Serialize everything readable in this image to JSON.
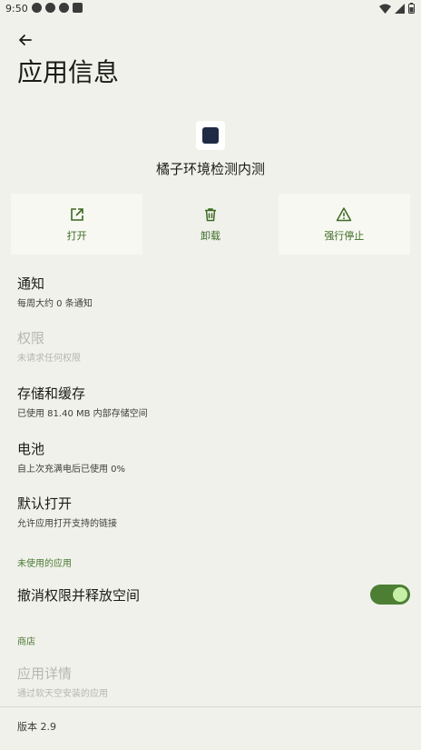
{
  "status_bar": {
    "time": "9:50",
    "left_icons": [
      "notification-icon",
      "telegram-icon",
      "telegram-icon",
      "android-icon"
    ],
    "right_icons": [
      "wifi-icon",
      "signal-icon",
      "battery-icon"
    ]
  },
  "header": {
    "title": "应用信息"
  },
  "app": {
    "name": "橘子环境检测内测",
    "icon": "app-icon"
  },
  "actions": [
    {
      "label": "打开",
      "icon": "open-external-icon"
    },
    {
      "label": "卸载",
      "icon": "trash-icon"
    },
    {
      "label": "强行停止",
      "icon": "warning-icon"
    }
  ],
  "settings": {
    "notifications": {
      "title": "通知",
      "subtitle": "每周大约 0 条通知"
    },
    "permissions": {
      "title": "权限",
      "subtitle": "未请求任何权限"
    },
    "storage": {
      "title": "存储和缓存",
      "subtitle": "已使用 81.40 MB 内部存储空间"
    },
    "battery": {
      "title": "电池",
      "subtitle": "自上次充满电后已使用 0%"
    },
    "open_by_default": {
      "title": "默认打开",
      "subtitle": "允许应用打开支持的链接"
    }
  },
  "unused_section": {
    "label": "未使用的应用",
    "revoke": {
      "title": "撤消权限并释放空间",
      "enabled": true
    }
  },
  "store_section": {
    "label": "商店",
    "details": {
      "title": "应用详情",
      "subtitle": "通过软天空安装的应用"
    }
  },
  "footer": {
    "version": "版本 2.9"
  },
  "colors": {
    "accent": "#3b6b23",
    "toggle_track": "#4c7f34",
    "background": "#f1f1ec"
  }
}
